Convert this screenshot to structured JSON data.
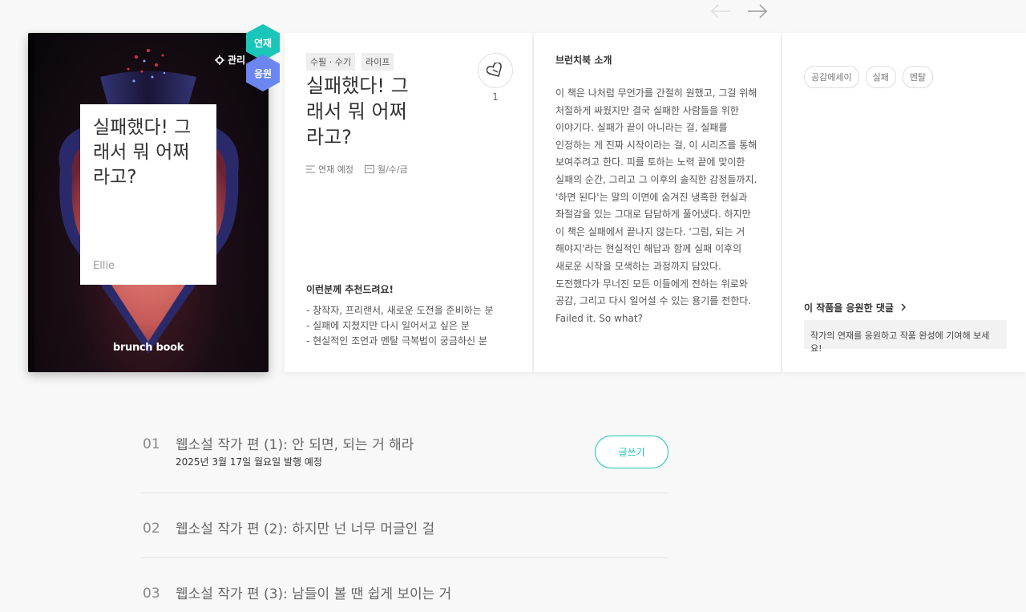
{
  "cover": {
    "manage_label": "관리",
    "title": "실패했다! 그래서 뭐 어쩌라고?",
    "author": "Ellie",
    "brand": "brunch book",
    "badge_serial": "연재",
    "badge_support": "응원"
  },
  "info": {
    "tags": [
      "수필 · 수기",
      "라이프"
    ],
    "title": "실패했다! 그래서 뭐 어쩌라고?",
    "like_count": "1",
    "schedule_label": "연재 예정",
    "days": "월/수/금",
    "recommend_title": "이런분께 추천드려요!",
    "recommend_items": [
      "- 창작자, 프리랜서, 새로운 도전을 준비하는 분",
      "- 실패에 지쳤지만 다시 일어서고 싶은 분",
      "- 현실적인 조언과 멘탈 극복법이 궁금하신 분"
    ]
  },
  "intro": {
    "heading": "브런치북 소개",
    "body": "이 책은 나처럼 무언가를 간절히 원했고, 그걸 위해 처절하게 싸웠지만 결국 실패한 사람들을 위한 이야기다. 실패가 끝이 아니라는 걸, 실패를 인정하는 게 진짜 시작이라는 걸, 이 시리즈를 통해 보여주려고 한다. 피를 토하는 노력 끝에 맞이한 실패의 순간, 그리고 그 이후의 솔직한 감정들까지. '하면 된다'는 말의 이면에 숨겨진 냉혹한 현실과 좌절감을 있는 그대로 담담하게 풀어냈다. 하지만 이 책은 실패에서 끝나지 않는다. '그럼, 되는 거 해야지'라는 현실적인 해답과 함께 실패 이후의 새로운 시작을 모색하는 과정까지 담았다. 도전했다가 무너진 모든 이들에게 전하는 위로와 공감, 그리고 다시 일어설 수 있는 용기를 전한다. Failed it. So what?"
  },
  "keywords": {
    "items": [
      "공감에세이",
      "실패",
      "멘탈"
    ],
    "cheer_link": "이 작품을 응원한 댓글",
    "cheer_cta": "작가의 연재를 응원하고 작품 완성에 기여해 보세요!"
  },
  "episodes": [
    {
      "num": "01",
      "title": "웹소설 작가 편 (1): 안 되면, 되는 거 해라",
      "date": "2025년 3월 17일 월요일 발행 예정"
    },
    {
      "num": "02",
      "title": "웹소설 작가 편 (2): 하지만 넌 너무 머글인 걸",
      "date": ""
    },
    {
      "num": "03",
      "title": "웹소설 작가 편 (3): 남들이 볼 땐 쉽게 보이는 거",
      "date": ""
    }
  ],
  "write_button": "글쓰기",
  "colors": {
    "accent": "#19c6b9",
    "support": "#6b86ef"
  }
}
